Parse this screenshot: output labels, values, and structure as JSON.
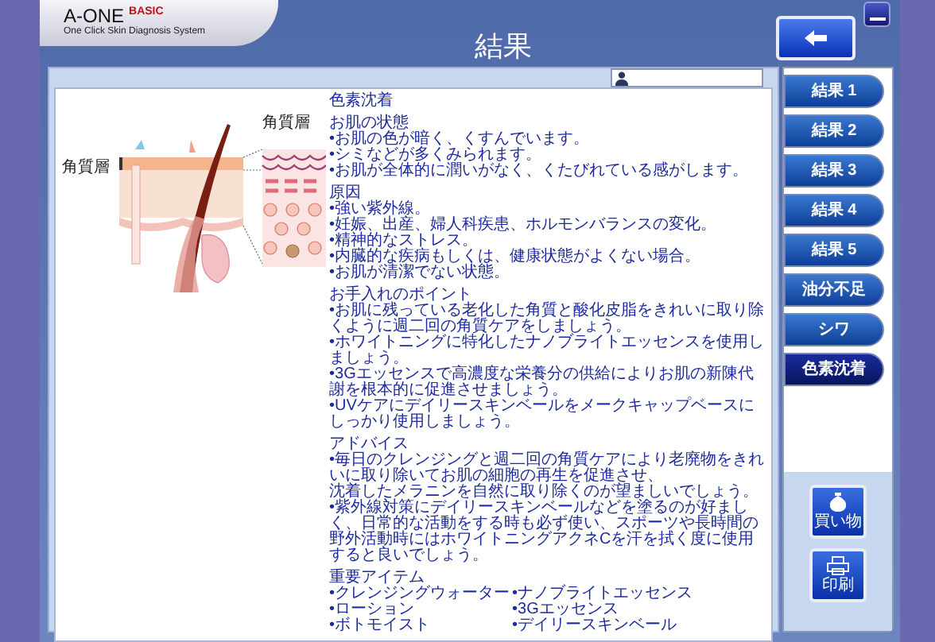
{
  "app": {
    "logo": "A-ONE",
    "edition": "BASIC",
    "tagline": "One Click Skin Diagnosis System"
  },
  "window": {
    "title": "結果"
  },
  "illustration": {
    "labels": [
      "角質層",
      "角質層"
    ]
  },
  "report": {
    "heading": "色素沈着",
    "sections": [
      {
        "title": "お肌の状態",
        "kind": "list",
        "items": [
          "•お肌の色が暗く、くすんでいます。",
          "•シミなどが多くみられます。",
          "•お肌が全体的に潤いがなく、くたびれている感がします。"
        ]
      },
      {
        "title": "原因",
        "kind": "list",
        "items": [
          "•強い紫外線。",
          "•妊娠、出産、婦人科疾患、ホルモンバランスの変化。",
          "•精神的なストレス。",
          "•内臓的な疾病もしくは、健康状態がよくない場合。",
          "•お肌が清潔でない状態。"
        ]
      },
      {
        "title": "お手入れのポイント",
        "kind": "list",
        "items": [
          "•お肌に残っている老化した角質と酸化皮脂をきれいに取り除くように週二回の角質ケアをしましょう。",
          "•ホワイトニングに特化したナノブライトエッセンスを使用しましょう。",
          "•3Gエッセンスで高濃度な栄養分の供給によりお肌の新陳代謝を根本的に促進させましょう。",
          "•UVケアにデイリースキンベールをメークキャップベースにしっかり使用しましょう。"
        ]
      },
      {
        "title": "アドバイス",
        "kind": "list",
        "items": [
          "•毎日のクレンジングと週二回の角質ケアにより老廃物をきれいに取り除いてお肌の細胞の再生を促進させ、",
          "沈着したメラニンを自然に取り除くのが望ましいでしょう。",
          "•紫外線対策にデイリースキンベールなどを塗るのが好ましく、日常的な活動をする時も必ず使い、スポーツや長時間の野外活動時にはホワイトニングアクネCを汗を拭く度に使用すると良いでしょう。"
        ]
      },
      {
        "title": "重要アイテム",
        "kind": "grid",
        "items": [
          "•クレンジングウォーター",
          "•ナノブライトエッセンス",
          "•ローション",
          "•3Gエッセンス",
          "•ボトモイスト",
          "•デイリースキンベール"
        ]
      }
    ]
  },
  "tabs": [
    {
      "label": "結果 1",
      "selected": false
    },
    {
      "label": "結果 2",
      "selected": false
    },
    {
      "label": "結果 3",
      "selected": false
    },
    {
      "label": "結果 4",
      "selected": false
    },
    {
      "label": "結果 5",
      "selected": false
    },
    {
      "label": "油分不足",
      "selected": false
    },
    {
      "label": "シワ",
      "selected": false
    },
    {
      "label": "色素沈着",
      "selected": true
    }
  ],
  "actions": [
    {
      "label": "買い物",
      "kind": "shop"
    },
    {
      "label": "印刷",
      "kind": "print"
    }
  ]
}
